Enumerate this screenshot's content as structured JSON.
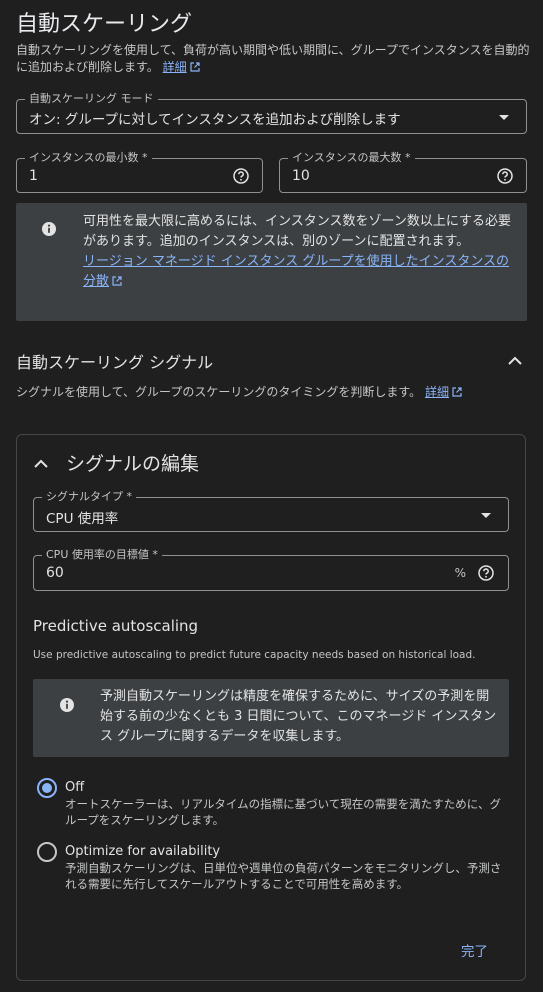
{
  "autoscaling": {
    "title": "自動スケーリング",
    "description": "自動スケーリングを使用して、負荷が高い期間や低い期間に、グループでインスタンスを自動的に追加および削除します。",
    "learn_more": "詳細",
    "mode": {
      "label": "自動スケーリング モード",
      "value": "オン: グループに対してインスタンスを追加および削除します"
    },
    "min_instances": {
      "label": "インスタンスの最小数 *",
      "value": "1"
    },
    "max_instances": {
      "label": "インスタンスの最大数 *",
      "value": "10"
    },
    "info": {
      "text": "可用性を最大限に高めるには、インスタンス数をゾーン数以上にする必要があります。追加のインスタンスは、別のゾーンに配置されます。",
      "link": "リージョン マネージド インスタンス グループを使用したインスタンスの分散"
    }
  },
  "signals": {
    "title": "自動スケーリング シグナル",
    "description": "シグナルを使用して、グループのスケーリングのタイミングを判断します。",
    "learn_more": "詳細"
  },
  "edit_signal": {
    "title": "シグナルの編集",
    "signal_type": {
      "label": "シグナルタイプ *",
      "value": "CPU 使用率"
    },
    "cpu_target": {
      "label": "CPU 使用率の目標値 *",
      "value": "60",
      "unit": "%"
    },
    "predictive": {
      "title": "Predictive autoscaling",
      "description": "Use predictive autoscaling to predict future capacity needs based on historical load.",
      "info": "予測自動スケーリングは精度を確保するために、サイズの予測を開始する前の少なくとも 3 日間について、このマネージド インスタンス グループに関するデータを収集します。",
      "options": [
        {
          "title": "Off",
          "description": "オートスケーラーは、リアルタイムの指標に基づいて現在の需要を満たすために、グループをスケーリングします。",
          "selected": true
        },
        {
          "title": "Optimize for availability",
          "description": "予測自動スケーリングは、日単位や週単位の負荷パターンをモニタリングし、予測される需要に先行してスケールアウトすることで可用性を高めます。",
          "selected": false
        }
      ]
    },
    "done": "完了"
  },
  "colors": {
    "background": "#1f1f1f",
    "accent": "#8ab4f8",
    "info_bg": "#3c4043"
  }
}
